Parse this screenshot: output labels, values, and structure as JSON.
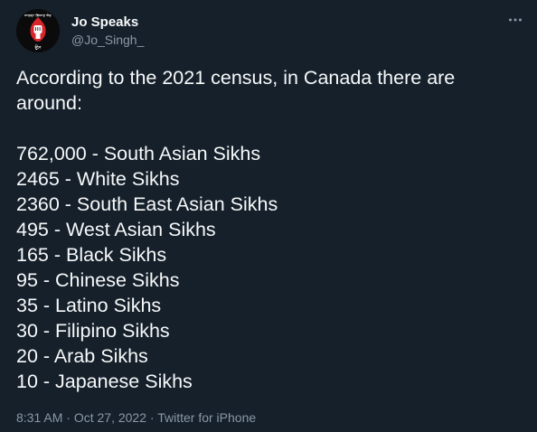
{
  "author": {
    "display_name": "Jo Speaks",
    "handle": "@Jo_Singh_",
    "avatar_text_top": "ਜਾਗਦਾ ਵਿਜਾਣ ਜੋਰ",
    "avatar_text_bottom": "ਉਸ"
  },
  "tweet": {
    "intro_line1": "According to the 2021 census, in Canada there are",
    "intro_line2": "around:",
    "items": [
      "762,000 - South Asian Sikhs",
      "2465 - White Sikhs",
      "2360 - South East Asian Sikhs",
      "495 - West Asian Sikhs",
      "165 - Black Sikhs",
      "95 - Chinese Sikhs",
      "35 - Latino Sikhs",
      "30 - Filipino Sikhs",
      "20 - Arab Sikhs",
      "10 - Japanese Sikhs"
    ]
  },
  "meta": {
    "time": "8:31 AM",
    "separator": " · ",
    "date": "Oct 27, 2022",
    "source": "Twitter for iPhone"
  },
  "icons": {
    "more": "more-options-icon"
  },
  "colors": {
    "background": "#15202b",
    "text_primary": "#f7f9f9",
    "text_secondary": "#8b98a5",
    "avatar_accent": "#d8262a"
  }
}
